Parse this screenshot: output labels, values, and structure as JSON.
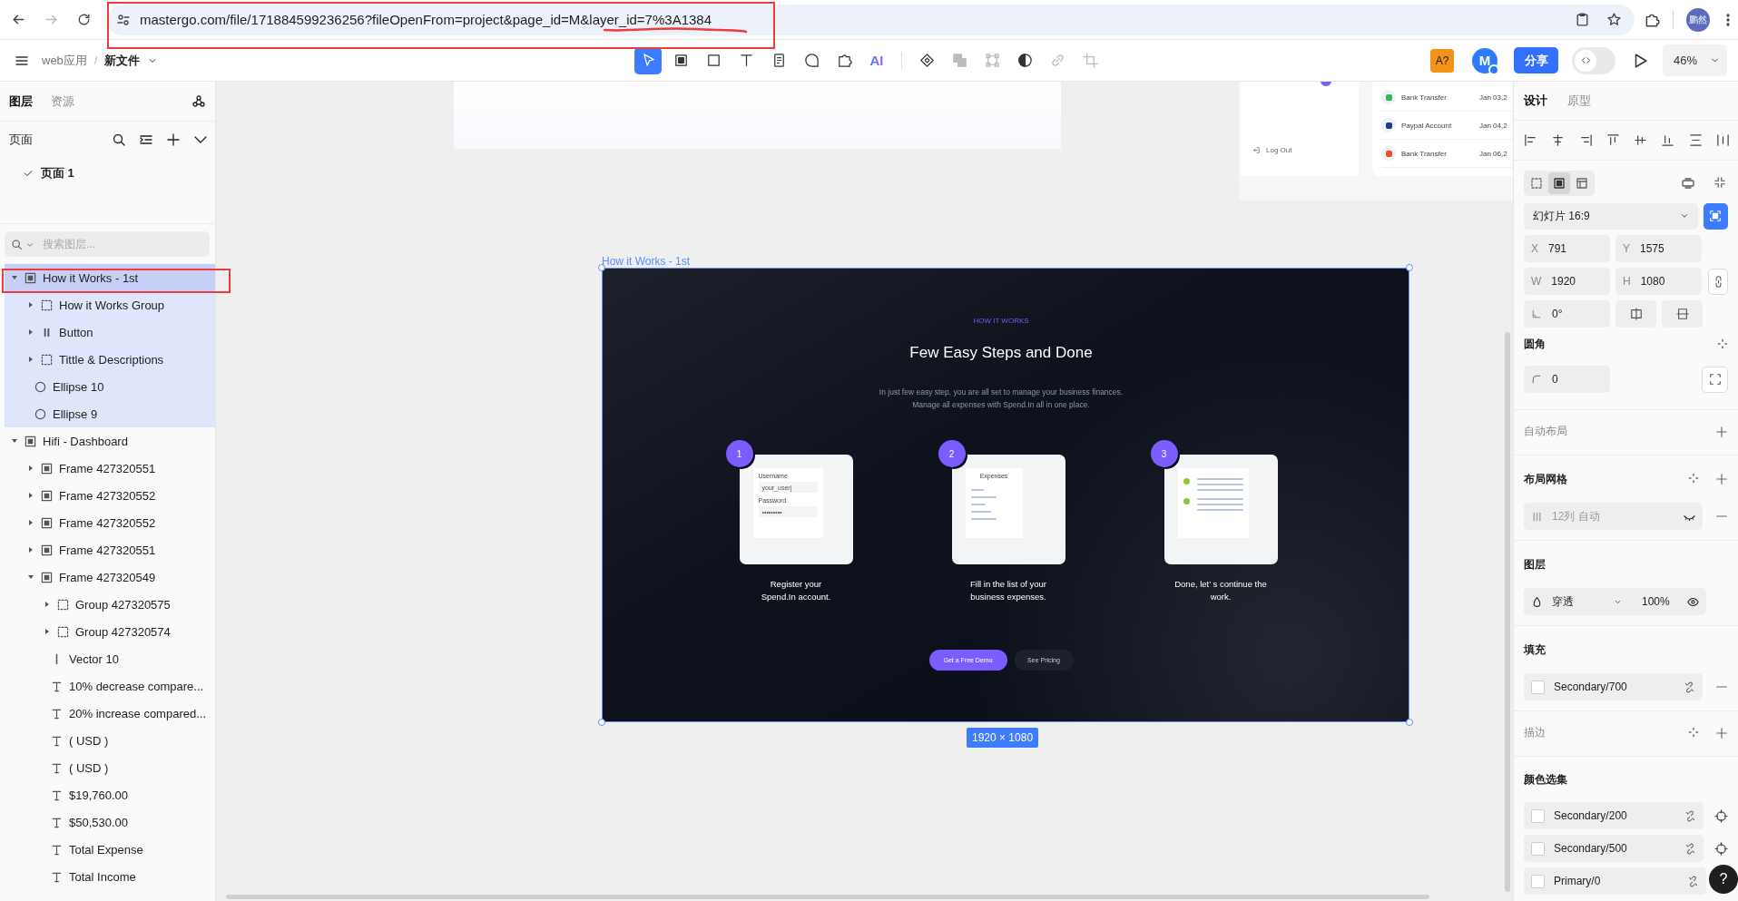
{
  "browser": {
    "url": "mastergo.com/file/171884599236256?fileOpenFrom=project&page_id=M&layer_id=7%3A1384",
    "forward_disabled": true,
    "profile": "鹏然"
  },
  "toolbar": {
    "project": "web应用",
    "separator": "/",
    "file": "新文件",
    "tools": [
      {
        "kind": "move",
        "selected": true,
        "disabled": false
      },
      {
        "kind": "frame",
        "selected": false,
        "disabled": false
      },
      {
        "kind": "rect",
        "selected": false,
        "disabled": false
      },
      {
        "kind": "text",
        "selected": false,
        "disabled": false
      },
      {
        "kind": "note",
        "selected": false,
        "disabled": false
      },
      {
        "kind": "comment",
        "selected": false,
        "disabled": false
      },
      {
        "kind": "plugin",
        "selected": false,
        "disabled": false
      },
      {
        "kind": "ai",
        "label": "AI",
        "selected": false,
        "disabled": false
      },
      {
        "kind": "component",
        "selected": false,
        "disabled": false
      },
      {
        "kind": "boolean",
        "selected": false,
        "disabled": true
      },
      {
        "kind": "corners",
        "selected": false,
        "disabled": true
      },
      {
        "kind": "contrast",
        "selected": false,
        "disabled": false
      },
      {
        "kind": "link",
        "selected": false,
        "disabled": true
      },
      {
        "kind": "crop",
        "selected": false,
        "disabled": true
      }
    ],
    "badge": "A?",
    "avatar": "M",
    "share": "分享",
    "dev_mode": false,
    "zoom": "46%"
  },
  "layers_panel": {
    "tabs": [
      {
        "label": "图层",
        "selected": true
      },
      {
        "label": "资源",
        "selected": false
      }
    ],
    "pages_title": "页面",
    "pages": [
      {
        "label": "页面 1",
        "selected": true
      }
    ],
    "search": {
      "placeholder": "搜索图层..."
    },
    "layers": [
      {
        "label": "How it Works - 1st",
        "kind": "frame",
        "expanded": true,
        "selected": true,
        "children": [
          {
            "label": "How it Works Group",
            "kind": "group",
            "expanded": false,
            "selected": false
          },
          {
            "label": "Button",
            "kind": "button",
            "expanded": false,
            "selected": false
          },
          {
            "label": "Tittle & Descriptions",
            "kind": "group",
            "expanded": false,
            "selected": false
          },
          {
            "label": "Ellipse 10",
            "kind": "ellipse",
            "selected": false
          },
          {
            "label": "Ellipse 9",
            "kind": "ellipse",
            "selected": false
          }
        ]
      },
      {
        "label": "Hifi - Dashboard",
        "kind": "frame",
        "expanded": true,
        "selected": false,
        "children": [
          {
            "label": "Frame 427320551",
            "kind": "frame",
            "expanded": false,
            "selected": false
          },
          {
            "label": "Frame 427320552",
            "kind": "frame",
            "expanded": false,
            "selected": false
          },
          {
            "label": "Frame 427320552",
            "kind": "frame",
            "expanded": false,
            "selected": false
          },
          {
            "label": "Frame 427320551",
            "kind": "frame",
            "expanded": false,
            "selected": false
          },
          {
            "label": "Frame 427320549",
            "kind": "frame",
            "expanded": true,
            "selected": false,
            "children": [
              {
                "label": "Group 427320575",
                "kind": "group",
                "expanded": false,
                "selected": false
              },
              {
                "label": "Group 427320574",
                "kind": "group",
                "expanded": false,
                "selected": false
              },
              {
                "label": "Vector 10",
                "kind": "vector",
                "selected": false
              },
              {
                "label": "10% decrease compare...",
                "kind": "text",
                "selected": false
              },
              {
                "label": "20% increase compared...",
                "kind": "text",
                "selected": false
              },
              {
                "label": "( USD )",
                "kind": "text",
                "selected": false
              },
              {
                "label": "( USD )",
                "kind": "text",
                "selected": false
              },
              {
                "label": "$19,760.00",
                "kind": "text",
                "selected": false
              },
              {
                "label": "$50,530.00",
                "kind": "text",
                "selected": false
              },
              {
                "label": "Total Expense",
                "kind": "text",
                "selected": false
              },
              {
                "label": "Total Income",
                "kind": "text",
                "selected": false
              }
            ]
          }
        ]
      }
    ]
  },
  "canvas": {
    "frame_label": "How it Works - 1st",
    "size": "1920 × 1080",
    "frame": {
      "eyebrow": "HOW IT WORKS",
      "title": "Few Easy Steps and Done",
      "description": [
        "In just few easy step, you are all set to manage your business finances.",
        "Manage all expenses with Spend.In all in one place."
      ],
      "steps": [
        {
          "number": "1",
          "kind": "login",
          "caption": [
            "Register your",
            "Spend.In account."
          ],
          "texts": [
            "Username",
            "your_user|",
            "Password",
            "•••••••••"
          ]
        },
        {
          "number": "2",
          "kind": "list",
          "caption": [
            "Fill in the list of your",
            "business expenses."
          ],
          "texts": [
            "Expenses"
          ]
        },
        {
          "number": "3",
          "kind": "checks",
          "caption": [
            "Done, let’ s continue the",
            "work."
          ]
        }
      ],
      "buttons": [
        {
          "label": "Get a Free Demo",
          "kind": "primary"
        },
        {
          "label": "See Pricing",
          "kind": "secondary"
        }
      ]
    },
    "dashboard_peek": {
      "logout": "Log Out",
      "transactions": [
        {
          "name": "Bank Transfer",
          "date": "Jan 03,2",
          "color": "#35b85a"
        },
        {
          "name": "Paypal Account",
          "date": "Jan 04,2",
          "color": "#1d3b8f"
        },
        {
          "name": "Bank Transfer",
          "date": "Jan 06,2",
          "color": "#f24e1e"
        }
      ]
    }
  },
  "design_panel": {
    "tabs": [
      {
        "label": "设计",
        "selected": true
      },
      {
        "label": "原型",
        "selected": false
      }
    ],
    "frame_modes": [
      {
        "kind": "free",
        "selected": false
      },
      {
        "kind": "frame",
        "selected": true
      },
      {
        "kind": "page",
        "selected": false
      }
    ],
    "preset": "幻灯片 16:9",
    "fields": [
      {
        "label": "X",
        "value": "791"
      },
      {
        "label": "Y",
        "value": "1575"
      },
      {
        "label": "W",
        "value": "1920"
      },
      {
        "label": "H",
        "value": "1080"
      }
    ],
    "rotation": "0°",
    "sections": [
      {
        "kind": "corner",
        "title": "圆角",
        "value": "0",
        "empty": false
      },
      {
        "kind": "auto_layout",
        "title": "自动布局",
        "empty": true
      },
      {
        "kind": "grid",
        "title": "布局网格",
        "value": "12列 自动",
        "visible": false,
        "empty": false
      },
      {
        "kind": "layer",
        "title": "图层",
        "blend": "穿透",
        "opacity": "100%",
        "empty": false
      },
      {
        "kind": "fill",
        "title": "填充",
        "value": "Secondary/700",
        "empty": false
      },
      {
        "kind": "stroke",
        "title": "描边",
        "empty": true
      },
      {
        "kind": "styles",
        "title": "颜色选集",
        "items": [
          "Secondary/200",
          "Secondary/500",
          "Primary/0"
        ],
        "empty": false
      }
    ],
    "help": "?"
  }
}
